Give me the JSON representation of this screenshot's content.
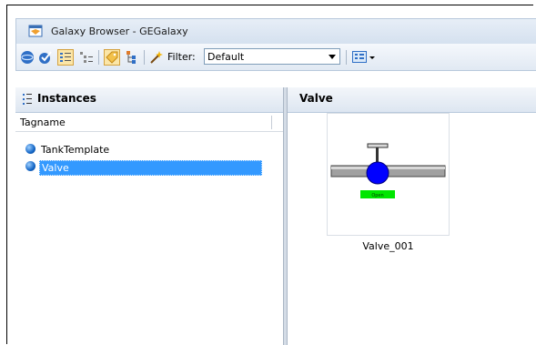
{
  "window": {
    "title": "Galaxy Browser - GEGalaxy"
  },
  "toolbar": {
    "filter_label": "Filter:",
    "filter_value": "Default",
    "buttons": [
      "galaxy-icon",
      "check-icon",
      "list-view-icon",
      "tree-view-icon",
      "tag-icon",
      "hierarchy-icon",
      "filter-wand-icon",
      "view-options-icon"
    ]
  },
  "left_pane": {
    "header": "Instances",
    "column_header": "Tagname",
    "items": [
      {
        "label": "TankTemplate",
        "selected": false
      },
      {
        "label": "Valve",
        "selected": true
      }
    ]
  },
  "right_pane": {
    "header": "Valve",
    "tiles": [
      {
        "label": "Valve_001",
        "status": "Open",
        "status_color": "#00e600"
      }
    ]
  },
  "colors": {
    "selection": "#3399ff",
    "valve_body": "#0000ff",
    "pipe": "#9a9a9a"
  }
}
